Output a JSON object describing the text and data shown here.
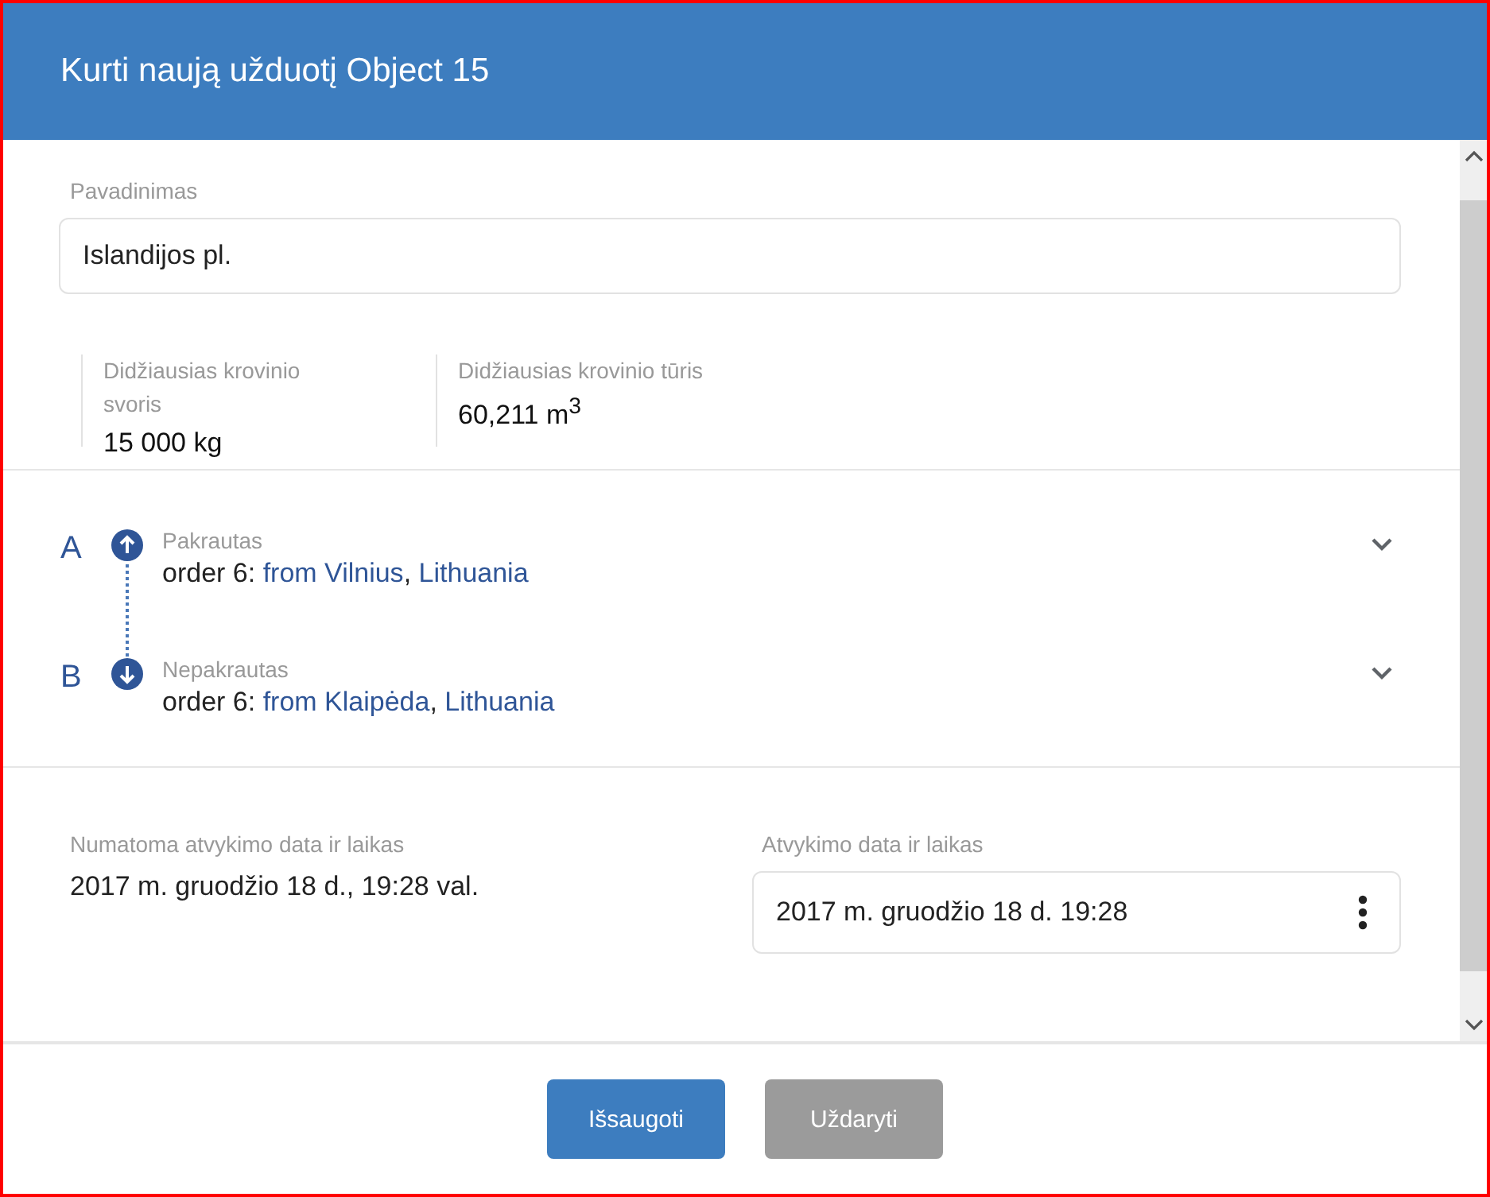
{
  "dialog": {
    "title": "Kurti naują užduotį Object 15"
  },
  "name_field": {
    "label": "Pavadinimas",
    "value": "Islandijos pl."
  },
  "stats": [
    {
      "label": "Didžiausias krovinio svoris",
      "value": "15 000 kg"
    },
    {
      "label": "Didžiausias krovinio tūris",
      "value": "60,211 m$^{3}$"
    }
  ],
  "stops": [
    {
      "letter": "A",
      "kind": "load",
      "status": "Pakrautas",
      "prefix": "order 6:",
      "place": "from Vilnius",
      "separator": ",",
      "country": "Lithuania",
      "expanded": false
    },
    {
      "letter": "B",
      "kind": "unload",
      "status": "Nepakrautas",
      "prefix": "order 6:",
      "place": "from Klaipėda",
      "separator": ",",
      "country": "Lithuania",
      "expanded": false
    }
  ],
  "estimated": {
    "label": "Numatoma atvykimo data ir laikas",
    "value": "2017 m. gruodžio 18 d., 19:28 val."
  },
  "arrival": {
    "label": "Atvykimo data ir laikas",
    "value": "2017 m. gruodžio 18 d. 19:28"
  },
  "buttons": [
    {
      "label": "Išsaugoti",
      "kind": "primary"
    },
    {
      "label": "Uždaryti",
      "kind": "secondary"
    }
  ]
}
